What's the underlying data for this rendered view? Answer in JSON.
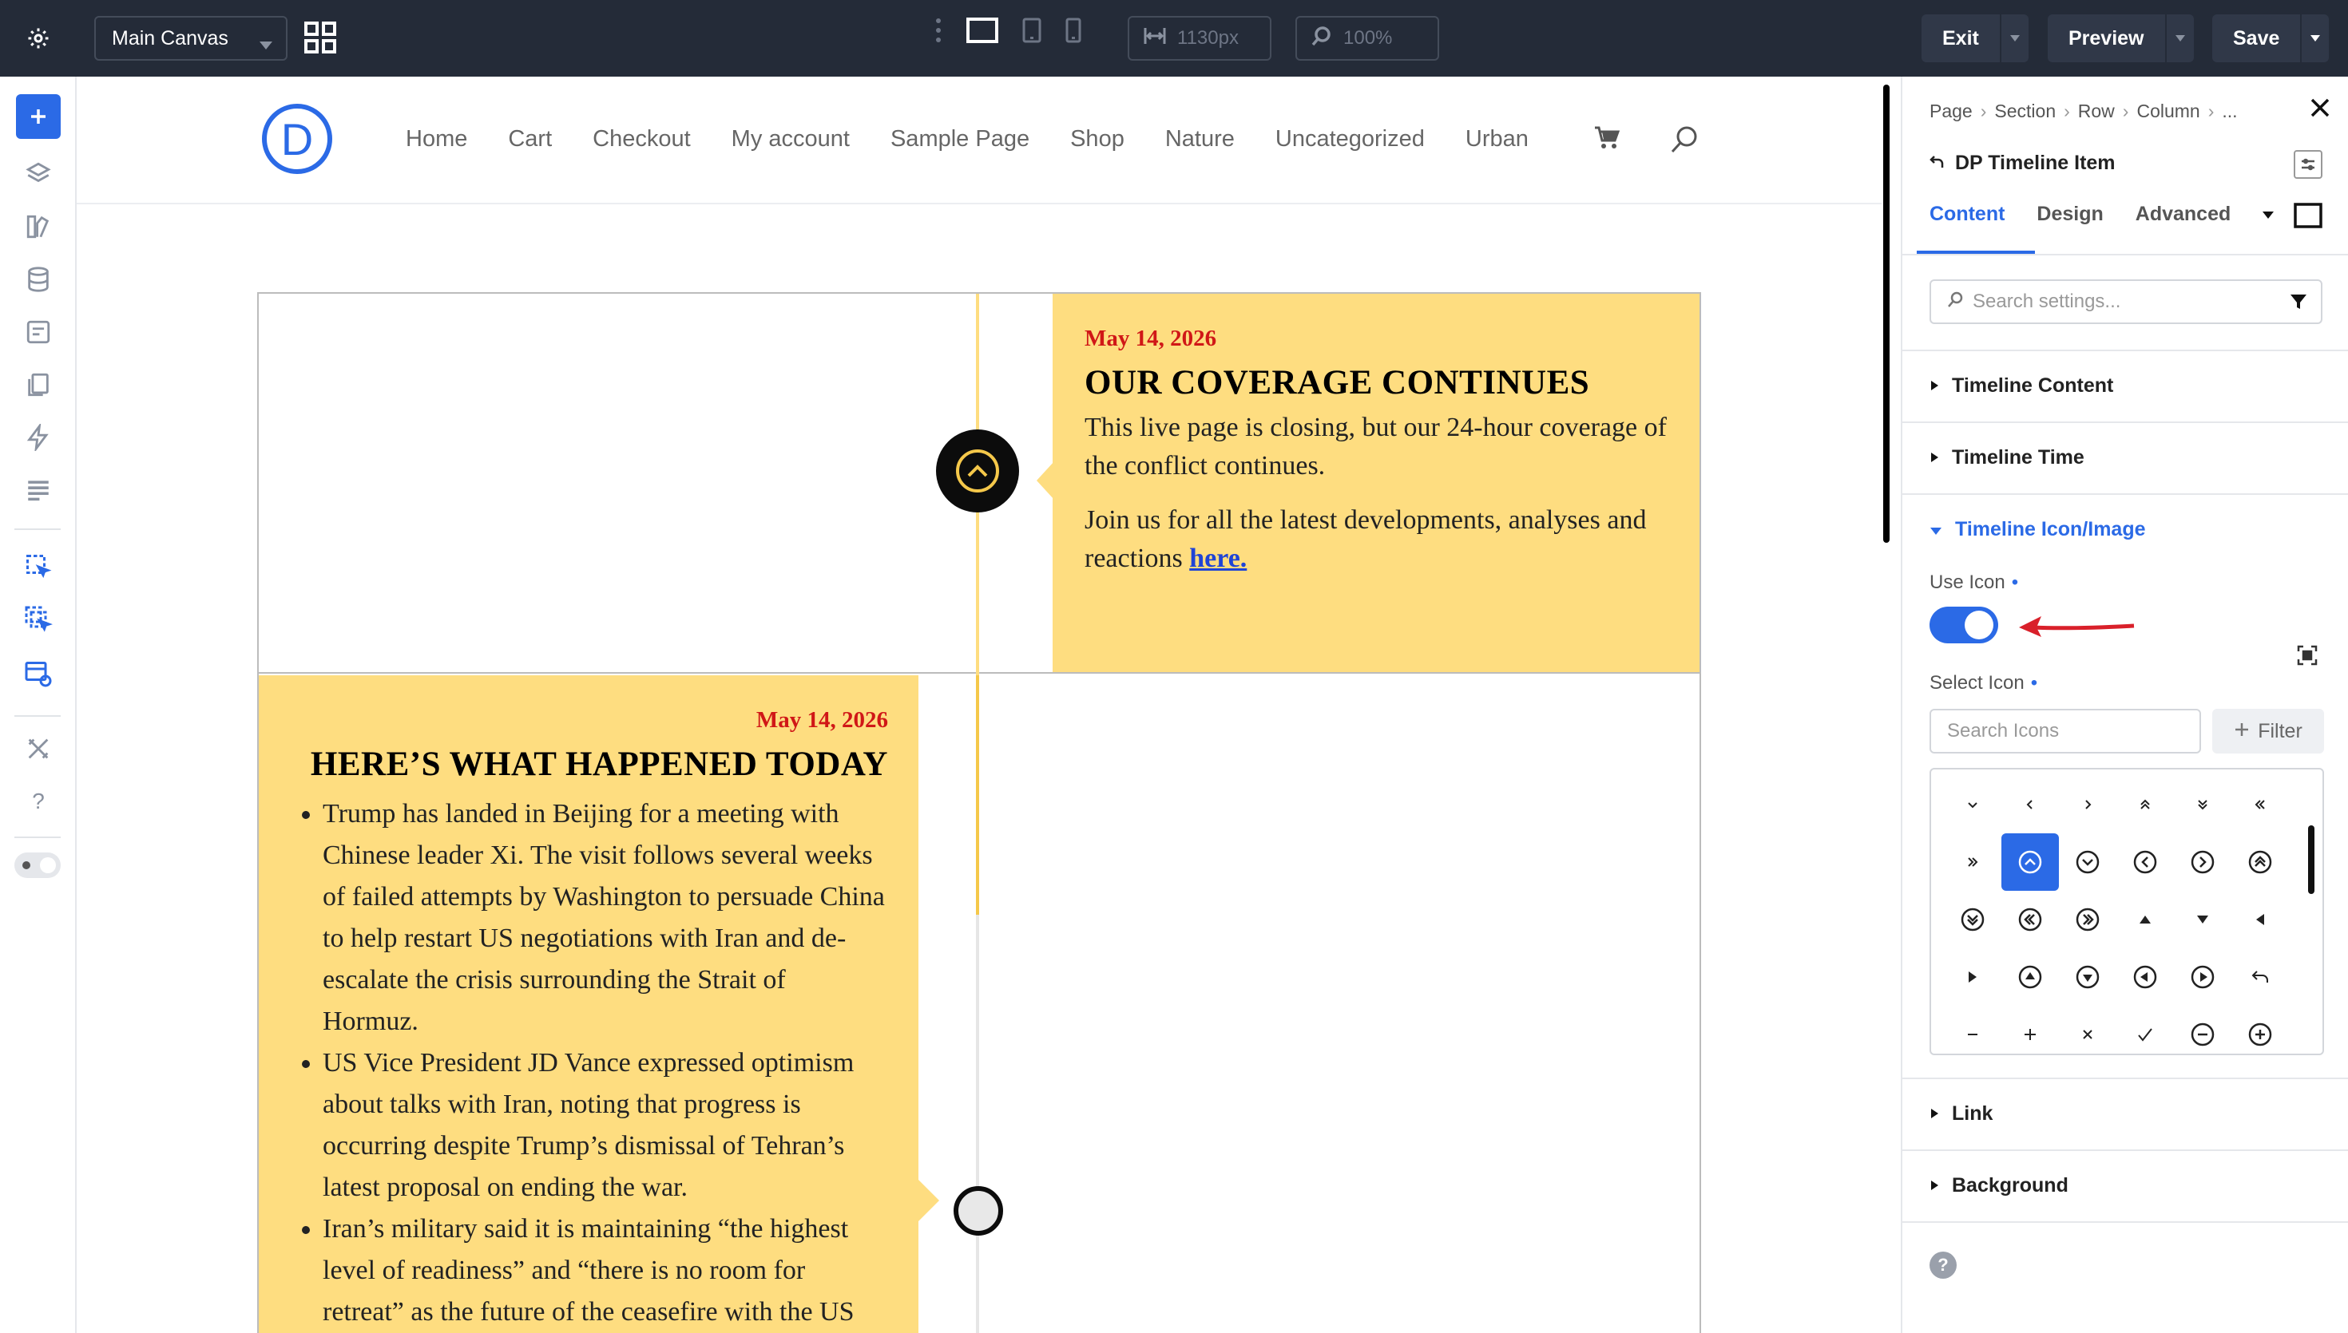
{
  "topbar": {
    "canvas_select": "Main Canvas",
    "width_value": "1130px",
    "zoom_value": "100%",
    "exit_label": "Exit",
    "preview_label": "Preview",
    "save_label": "Save"
  },
  "site": {
    "logo_letter": "D",
    "nav": [
      "Home",
      "Cart",
      "Checkout",
      "My account",
      "Sample Page",
      "Shop",
      "Nature",
      "Uncategorized",
      "Urban"
    ]
  },
  "timeline": {
    "item1": {
      "date": "May 14, 2026",
      "title": "OUR COVERAGE CONTINUES",
      "p1": "This live page is closing, but our 24-hour coverage of the conflict continues.",
      "p2_prefix": "Join us for all the latest developments, analyses and reactions ",
      "p2_link": "here."
    },
    "item2": {
      "date": "May 14, 2026",
      "title": "HERE’S WHAT HAPPENED TODAY",
      "bullets": [
        "Trump has landed in Beijing for a meeting with Chinese leader Xi. The visit follows several weeks of failed attempts by Washington to persuade China to help restart US negotiations with Iran and de-escalate the crisis surrounding the Strait of Hormuz.",
        "US Vice President JD Vance expressed optimism about talks with Iran, noting that progress is occurring despite Trump’s dismissal of Tehran’s latest proposal on ending the war.",
        "Iran’s military said it is maintaining “the highest level of readiness” and “there is no room for retreat” as the future of the ceasefire with the US"
      ]
    }
  },
  "panel": {
    "breadcrumb": [
      "Page",
      "Section",
      "Row",
      "Column",
      "..."
    ],
    "title": "DP Timeline Item",
    "tabs": [
      "Content",
      "Design",
      "Advanced"
    ],
    "search_placeholder": "Search settings...",
    "sections": {
      "timeline_content": "Timeline Content",
      "timeline_time": "Timeline Time",
      "timeline_icon": "Timeline Icon/Image",
      "link": "Link",
      "background": "Background"
    },
    "use_icon_label": "Use Icon",
    "use_icon_on": true,
    "select_icon_label": "Select Icon",
    "icon_search_placeholder": "Search Icons",
    "filter_label": "Filter",
    "help": "?"
  },
  "colors": {
    "accent": "#2b6ae6",
    "card_bg": "#fedd80",
    "date_red": "#d01717",
    "topbar": "#242b38",
    "annotation_arrow": "#d9202a"
  }
}
